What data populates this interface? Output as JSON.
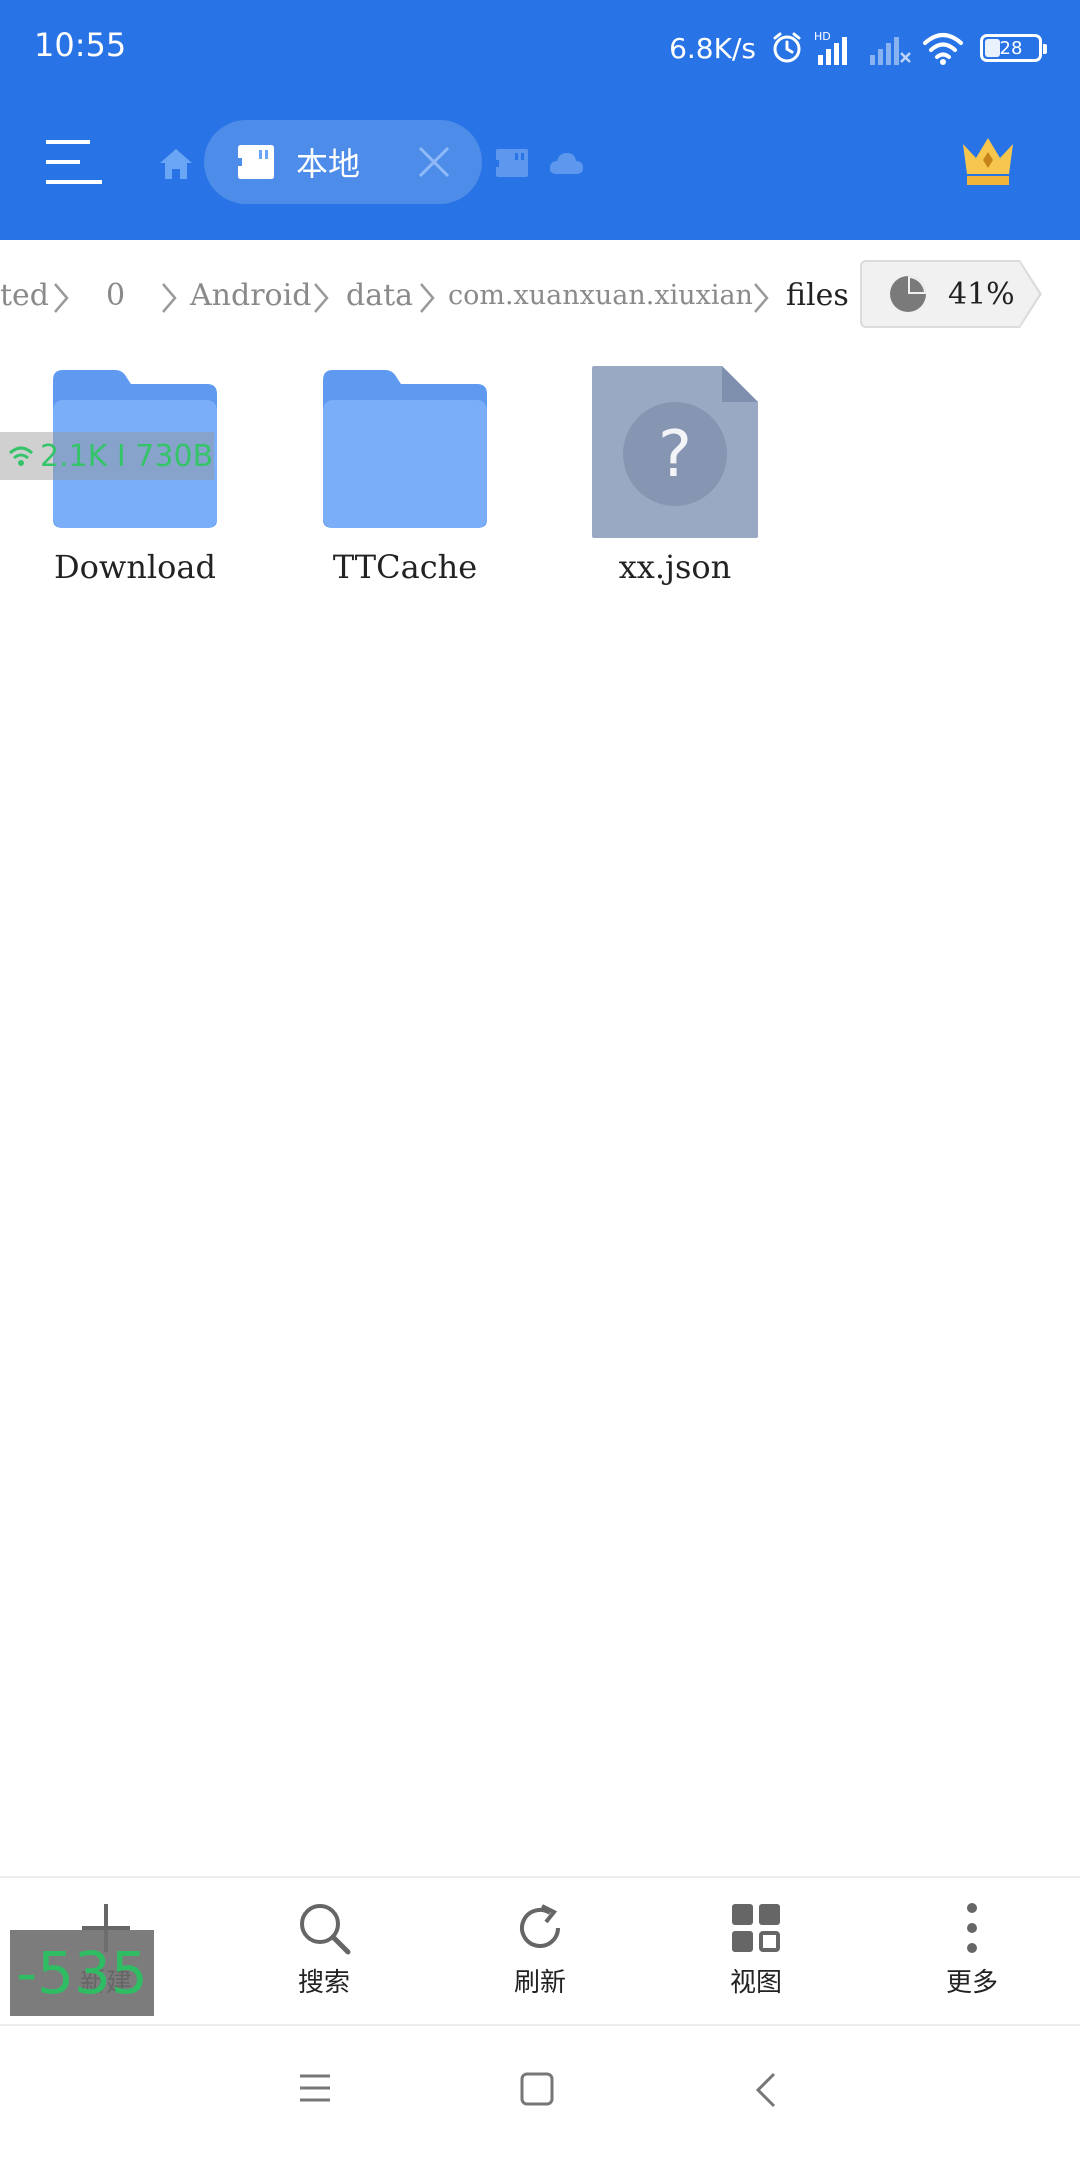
{
  "status_bar": {
    "time": "10:55",
    "net_speed": "6.8K/s",
    "hd_label": "HD",
    "battery": "28",
    "icons": [
      "alarm-icon",
      "signal-hd-icon",
      "signal-nosim-icon",
      "wifi-icon",
      "battery-icon"
    ]
  },
  "toolbar": {
    "tab_label": "本地",
    "icons": [
      "menu-icon",
      "home-icon",
      "sd-card-icon",
      "close-icon",
      "sd-card-icon",
      "cloud-icon",
      "vip-crown-icon"
    ]
  },
  "breadcrumb": {
    "items": [
      "ted",
      "0",
      "Android",
      "data",
      "com.xuanxuan.xiuxian",
      "files"
    ],
    "storage_percent": "41%"
  },
  "files": [
    {
      "name": "Download",
      "type": "folder"
    },
    {
      "name": "TTCache",
      "type": "folder"
    },
    {
      "name": "xx.json",
      "type": "unknown-file"
    }
  ],
  "net_overlay": "2.1K I 730B",
  "fps_overlay": "-535",
  "actions": [
    {
      "label": "新建",
      "icon": "plus-icon"
    },
    {
      "label": "搜索",
      "icon": "search-icon"
    },
    {
      "label": "刷新",
      "icon": "refresh-icon"
    },
    {
      "label": "视图",
      "icon": "grid-view-icon"
    },
    {
      "label": "更多",
      "icon": "more-vertical-icon"
    }
  ],
  "nav": [
    "recents-icon",
    "home-square-icon",
    "back-icon"
  ],
  "colors": {
    "accent": "#2873e6",
    "folder": "#7aaef8",
    "folder_tab": "#5f9af0",
    "unknown_file": "#9aa9c3",
    "overlay_green": "#35c46a"
  }
}
